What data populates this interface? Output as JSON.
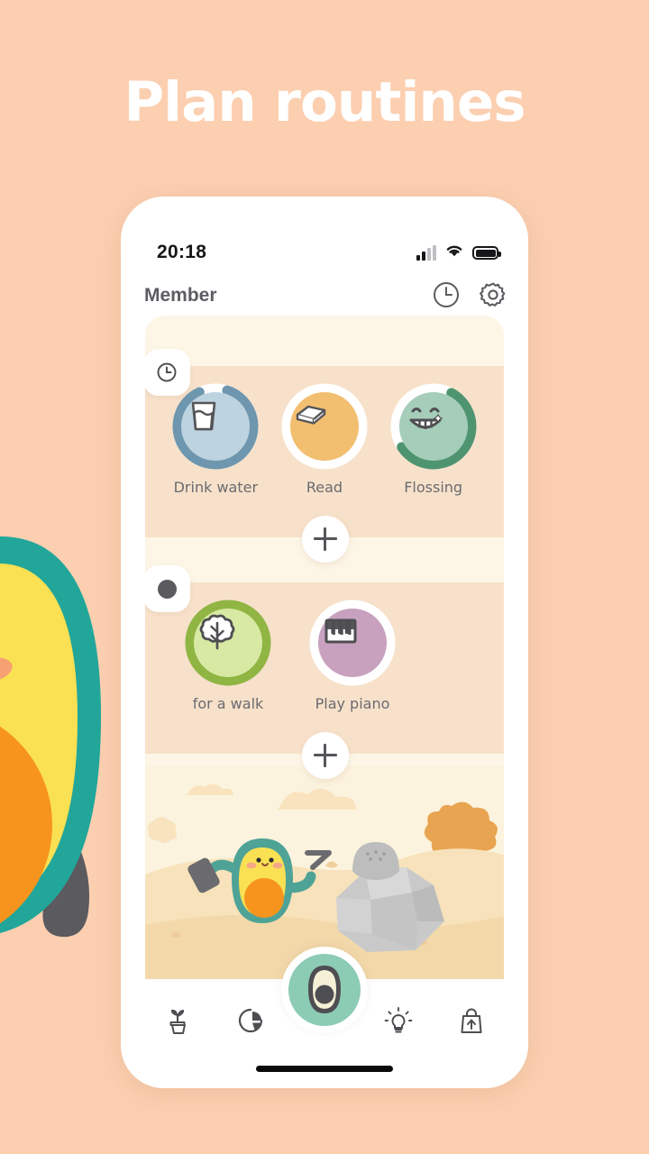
{
  "page": {
    "headline": "Plan routines",
    "background_color": "#FBCFB0"
  },
  "status_bar": {
    "time": "20:18",
    "icons": [
      "signal-icon",
      "wifi-icon",
      "battery-icon"
    ]
  },
  "app_header": {
    "title": "Member",
    "actions": [
      {
        "name": "clock-icon",
        "label": "History"
      },
      {
        "name": "gear-icon",
        "label": "Settings"
      }
    ]
  },
  "sections": [
    {
      "id": "morning",
      "badge_icon": "clock-icon",
      "add_label": "+",
      "habits": [
        {
          "label": "Drink water",
          "icon": "water-glass-icon",
          "disc_color": "#BDD3DF",
          "ring_color": "#6E96AE",
          "progress": 88
        },
        {
          "label": "Read",
          "icon": "book-icon",
          "disc_color": "#F2BE70",
          "ring_color": "#FFFFFF",
          "progress": 0
        },
        {
          "label": "Flossing",
          "icon": "smiling-teeth-icon",
          "disc_color": "#A5CDB9",
          "ring_color": "#4F9470",
          "progress": 58
        }
      ]
    },
    {
      "id": "evening",
      "badge_icon": "half-moon-icon",
      "add_label": "+",
      "habits": [
        {
          "label": "for a walk",
          "icon": "tree-icon",
          "disc_color": "#D7E9A3",
          "ring_color": "#90B543",
          "progress": 100
        },
        {
          "label": "Play piano",
          "icon": "piano-icon",
          "disc_color": "#C7A1BE",
          "ring_color": "#FFFFFF",
          "progress": 0
        }
      ]
    }
  ],
  "illustration": {
    "name": "avocado-mining-scene",
    "sky_color": "#FCF3DE",
    "ground_color": "#F7E2BB",
    "rock_color": "#C9C9C9",
    "bush_color": "#E8A450"
  },
  "bottom_nav": {
    "items": [
      {
        "name": "plant-pot-icon",
        "label": "Garden"
      },
      {
        "name": "pie-chart-icon",
        "label": "Stats"
      },
      {
        "name": "avocado-button",
        "label": "Home",
        "color": "#8CCBB4"
      },
      {
        "name": "lightbulb-icon",
        "label": "Tips"
      },
      {
        "name": "shopping-bag-icon",
        "label": "Shop"
      }
    ]
  },
  "mascot": {
    "name": "avocado-mascot",
    "skin_color": "#22A69A",
    "flesh_color": "#FAE053",
    "pit_color": "#F7941D"
  }
}
